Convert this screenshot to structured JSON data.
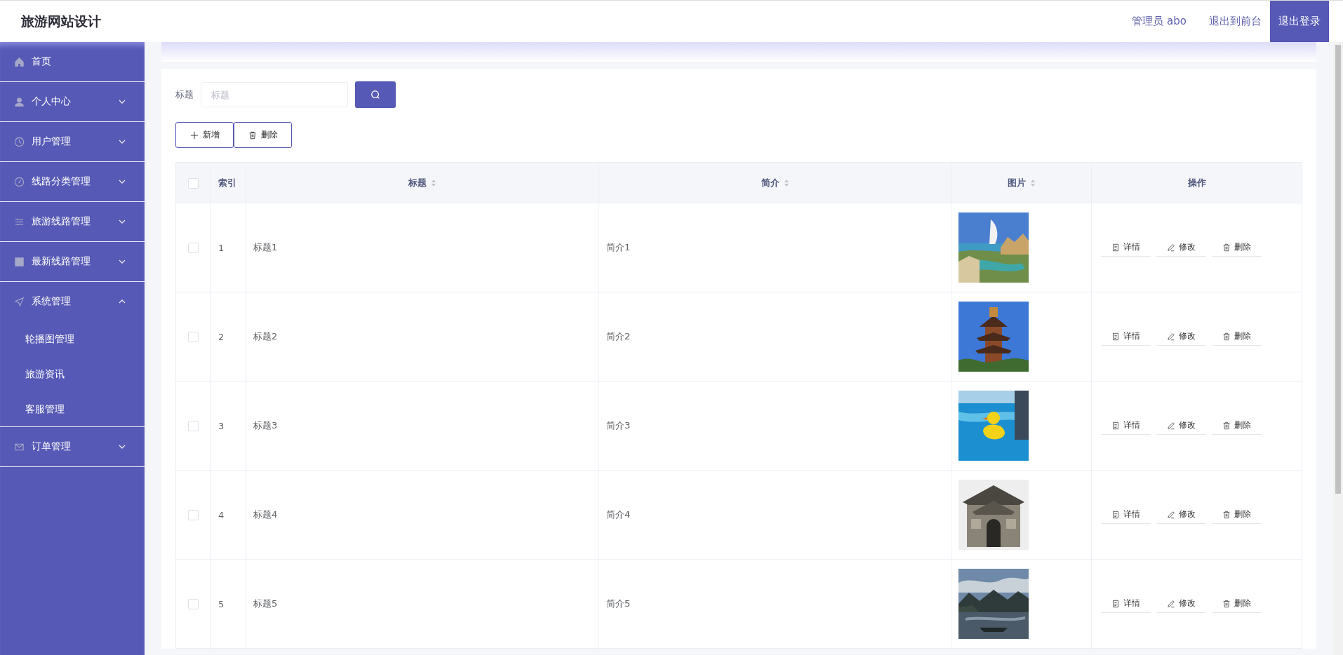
{
  "header": {
    "title": "旅游网站设计",
    "user": "管理员 abo",
    "links": [
      {
        "label": "退出到前台",
        "selected": false
      },
      {
        "label": "退出登录",
        "selected": true
      }
    ]
  },
  "sidebar": {
    "items": [
      {
        "label": "首页",
        "kind": "link"
      },
      {
        "label": "个人中心",
        "kind": "menu",
        "expanded": false
      },
      {
        "label": "用户管理",
        "kind": "menu",
        "expanded": false
      },
      {
        "label": "线路分类管理",
        "kind": "menu",
        "expanded": false
      },
      {
        "label": "旅游线路管理",
        "kind": "menu",
        "expanded": false
      },
      {
        "label": "最新线路管理",
        "kind": "menu",
        "expanded": false
      },
      {
        "label": "系统管理",
        "kind": "menu",
        "expanded": true,
        "children": [
          {
            "label": "轮播图管理"
          },
          {
            "label": "旅游资讯"
          },
          {
            "label": "客服管理"
          }
        ]
      },
      {
        "label": "订单管理",
        "kind": "menu",
        "expanded": false
      }
    ]
  },
  "search": {
    "label": "标题",
    "placeholder": "标题"
  },
  "toolbar": [
    "新增",
    "删除"
  ],
  "table": {
    "select_all": false,
    "columns": [
      {
        "label": "索引",
        "sortable": false
      },
      {
        "label": "标题",
        "sortable": true
      },
      {
        "label": "简介",
        "sortable": true
      },
      {
        "label": "图片",
        "sortable": true
      },
      {
        "label": "操作",
        "sortable": false
      }
    ],
    "rows": [
      {
        "selected": false,
        "index": "1",
        "title": "标题1",
        "intro": "简介1",
        "actions": [
          "详情",
          "修改",
          "删除"
        ]
      },
      {
        "selected": false,
        "index": "2",
        "title": "标题2",
        "intro": "简介2",
        "actions": [
          "详情",
          "修改",
          "删除"
        ]
      },
      {
        "selected": false,
        "index": "3",
        "title": "标题3",
        "intro": "简介3",
        "actions": [
          "详情",
          "修改",
          "删除"
        ]
      },
      {
        "selected": false,
        "index": "4",
        "title": "标题4",
        "intro": "简介4",
        "actions": [
          "详情",
          "修改",
          "删除"
        ]
      },
      {
        "selected": false,
        "index": "5",
        "title": "标题5",
        "intro": "简介5",
        "actions": [
          "详情",
          "修改",
          "删除"
        ]
      }
    ]
  }
}
